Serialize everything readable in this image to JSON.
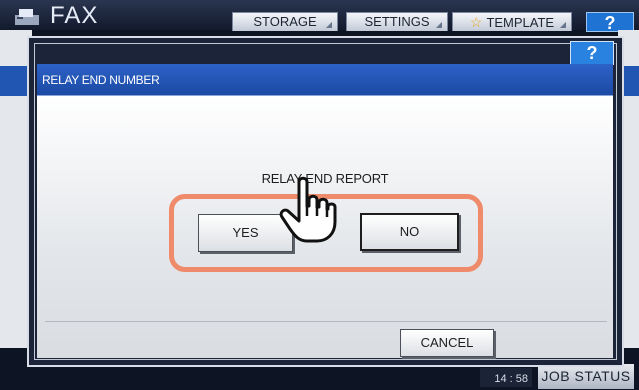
{
  "background": {
    "app_title": "FAX",
    "tabs": [
      {
        "label": "STORAGE"
      },
      {
        "label": "SETTINGS"
      },
      {
        "label": "TEMPLATE"
      }
    ],
    "help_label": "?",
    "clock": "14 : 58",
    "job_status_label": "JOB STATUS"
  },
  "dialog": {
    "help_label": "?",
    "title": "RELAY END NUMBER",
    "report_label": "RELAY END REPORT",
    "yes_label": "YES",
    "no_label": "NO",
    "cancel_label": "CANCEL"
  },
  "colors": {
    "title_bar": "#2c62c6",
    "highlight": "#ef8a6a",
    "help_button": "#2a82e0"
  },
  "icons": [
    "fax-icon",
    "star-icon",
    "pointing-hand-icon"
  ]
}
